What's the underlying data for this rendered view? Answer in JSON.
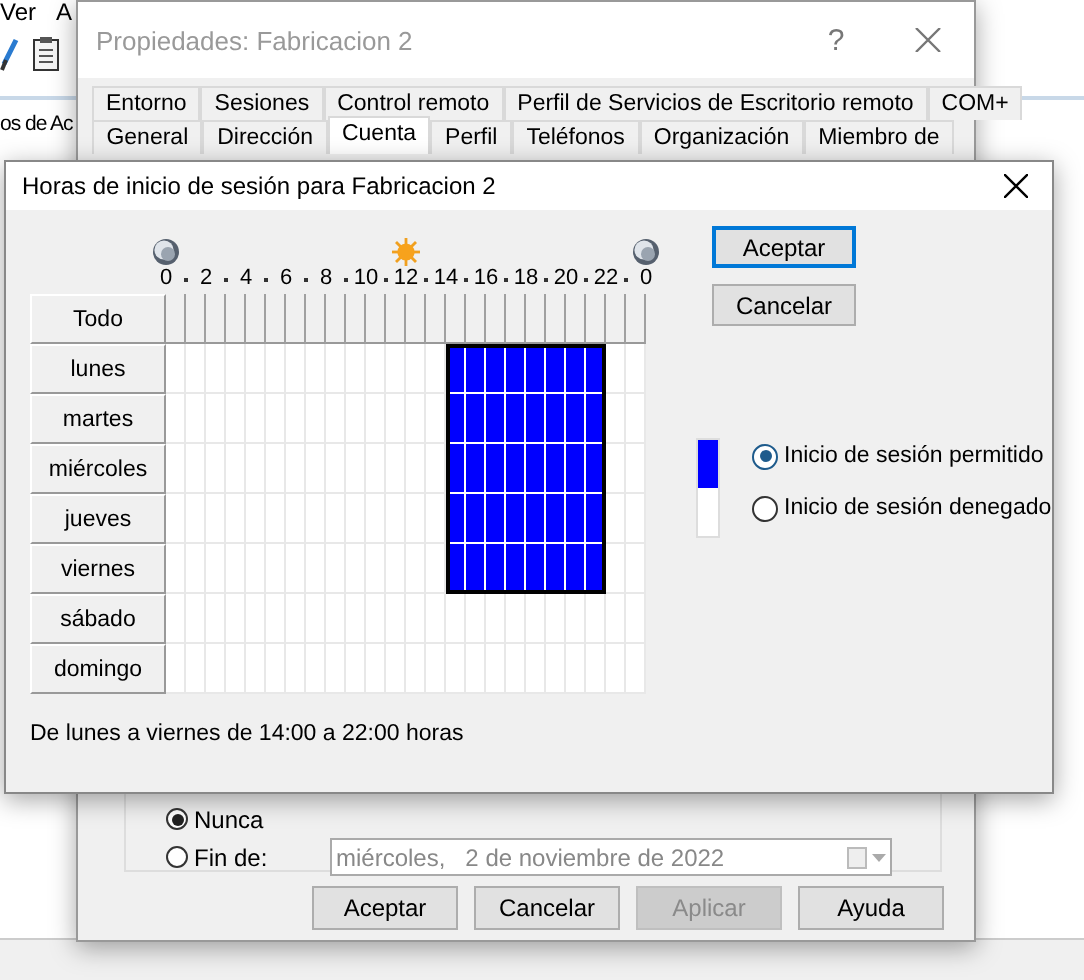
{
  "background_window": {
    "menu": [
      "Ver",
      "A"
    ],
    "tree_text": "os de Ac"
  },
  "properties_dialog": {
    "title": "Propiedades: Fabricacion 2",
    "help": "?",
    "tab_rows": [
      [
        {
          "label": "Entorno",
          "selected": false
        },
        {
          "label": "Sesiones",
          "selected": false
        },
        {
          "label": "Control remoto",
          "selected": false
        },
        {
          "label": "Perfil de Servicios de Escritorio remoto",
          "selected": false
        },
        {
          "label": "COM+",
          "selected": false
        }
      ],
      [
        {
          "label": "General",
          "selected": false
        },
        {
          "label": "Dirección",
          "selected": false
        },
        {
          "label": "Cuenta",
          "selected": true
        },
        {
          "label": "Perfil",
          "selected": false
        },
        {
          "label": "Teléfonos",
          "selected": false
        },
        {
          "label": "Organización",
          "selected": false
        },
        {
          "label": "Miembro de",
          "selected": false
        }
      ]
    ],
    "expiry_options": [
      {
        "label": "Nunca",
        "selected": true
      },
      {
        "label": "Fin de:",
        "selected": false
      }
    ],
    "date_field": {
      "value": "miércoles,   2 de noviembre de 2022",
      "disabled": true
    },
    "buttons": [
      {
        "label": "Aceptar",
        "disabled": false
      },
      {
        "label": "Cancelar",
        "disabled": false
      },
      {
        "label": "Aplicar",
        "disabled": true
      },
      {
        "label": "Ayuda",
        "disabled": false
      }
    ]
  },
  "logon_hours_dialog": {
    "title": "Horas de inicio de sesión para Fabricacion 2",
    "hour_labels": [
      "0",
      "2",
      "4",
      "6",
      "8",
      "10",
      "12",
      "14",
      "16",
      "18",
      "20",
      "22",
      "0"
    ],
    "all_button": "Todo",
    "days": [
      {
        "label": "lunes",
        "allowed": [
          false,
          false,
          false,
          false,
          false,
          false,
          false,
          false,
          false,
          false,
          false,
          false,
          false,
          false,
          true,
          true,
          true,
          true,
          true,
          true,
          true,
          true,
          false,
          false
        ]
      },
      {
        "label": "martes",
        "allowed": [
          false,
          false,
          false,
          false,
          false,
          false,
          false,
          false,
          false,
          false,
          false,
          false,
          false,
          false,
          true,
          true,
          true,
          true,
          true,
          true,
          true,
          true,
          false,
          false
        ]
      },
      {
        "label": "miércoles",
        "allowed": [
          false,
          false,
          false,
          false,
          false,
          false,
          false,
          false,
          false,
          false,
          false,
          false,
          false,
          false,
          true,
          true,
          true,
          true,
          true,
          true,
          true,
          true,
          false,
          false
        ]
      },
      {
        "label": "jueves",
        "allowed": [
          false,
          false,
          false,
          false,
          false,
          false,
          false,
          false,
          false,
          false,
          false,
          false,
          false,
          false,
          true,
          true,
          true,
          true,
          true,
          true,
          true,
          true,
          false,
          false
        ]
      },
      {
        "label": "viernes",
        "allowed": [
          false,
          false,
          false,
          false,
          false,
          false,
          false,
          false,
          false,
          false,
          false,
          false,
          false,
          false,
          true,
          true,
          true,
          true,
          true,
          true,
          true,
          true,
          false,
          false
        ]
      },
      {
        "label": "sábado",
        "allowed": [
          false,
          false,
          false,
          false,
          false,
          false,
          false,
          false,
          false,
          false,
          false,
          false,
          false,
          false,
          false,
          false,
          false,
          false,
          false,
          false,
          false,
          false,
          false,
          false
        ]
      },
      {
        "label": "domingo",
        "allowed": [
          false,
          false,
          false,
          false,
          false,
          false,
          false,
          false,
          false,
          false,
          false,
          false,
          false,
          false,
          false,
          false,
          false,
          false,
          false,
          false,
          false,
          false,
          false,
          false
        ]
      }
    ],
    "buttons": [
      {
        "label": "Aceptar",
        "default": true
      },
      {
        "label": "Cancelar",
        "default": false
      }
    ],
    "legend": [
      {
        "label": "Inicio de sesión permitido",
        "kind": "permitted",
        "selected": true
      },
      {
        "label": "Inicio de sesión denegado",
        "kind": "denied",
        "selected": false
      }
    ],
    "summary": "De lunes a viernes de 14:00 a 22:00 horas"
  }
}
